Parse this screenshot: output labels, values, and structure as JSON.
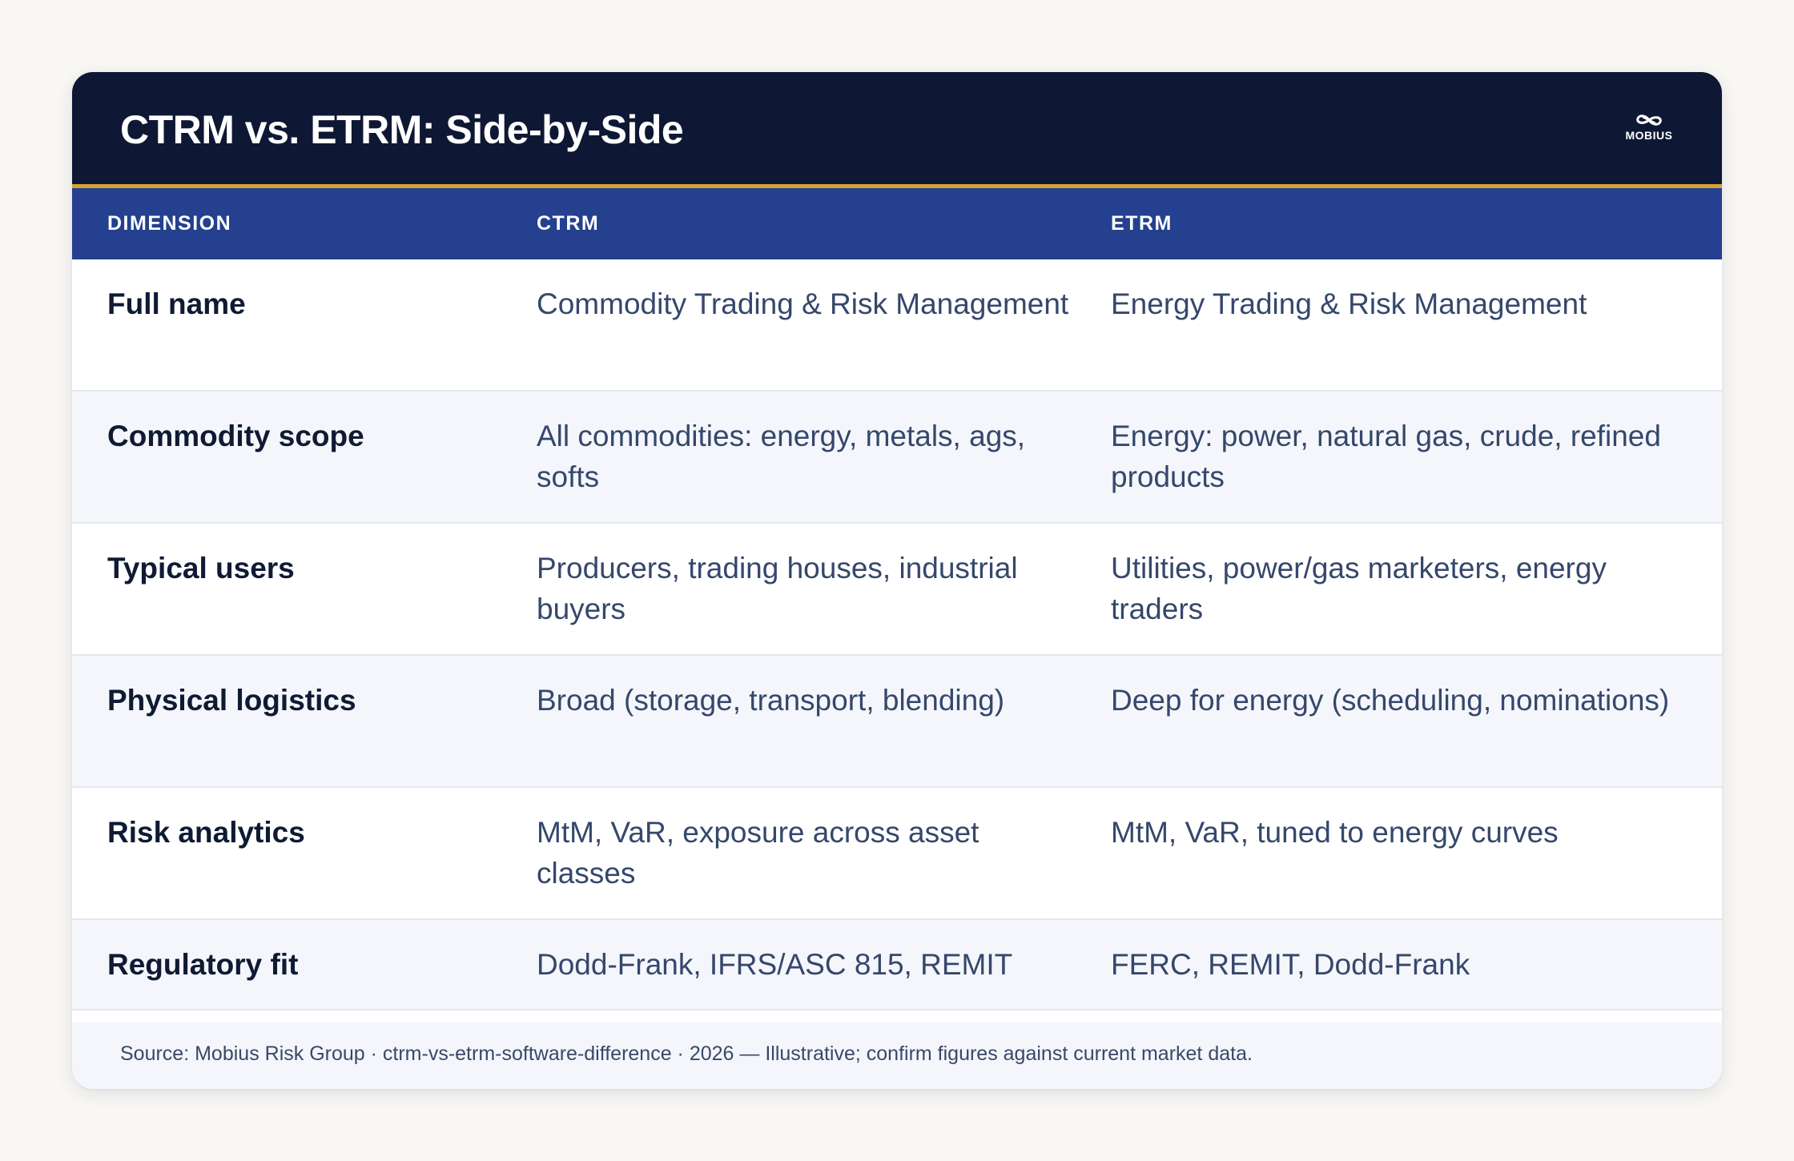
{
  "header": {
    "title": "CTRM vs. ETRM: Side-by-Side",
    "logo_text": "MOBIUS",
    "logo_icon": "infinity-icon"
  },
  "table": {
    "columns": [
      "DIMENSION",
      "CTRM",
      "ETRM"
    ],
    "rows": [
      {
        "dimension": "Full name",
        "ctrm": "Commodity Trading & Risk Management",
        "etrm": "Energy Trading & Risk Management"
      },
      {
        "dimension": "Commodity scope",
        "ctrm": "All commodities: energy, metals, ags, softs",
        "etrm": "Energy: power, natural gas, crude, refined products"
      },
      {
        "dimension": "Typical users",
        "ctrm": "Producers, trading houses, industrial buyers",
        "etrm": "Utilities, power/gas marketers, energy traders"
      },
      {
        "dimension": "Physical logistics",
        "ctrm": "Broad (storage, transport, blending)",
        "etrm": "Deep for energy (scheduling, nominations)"
      },
      {
        "dimension": "Risk analytics",
        "ctrm": "MtM, VaR, exposure across asset classes",
        "etrm": "MtM, VaR, tuned to energy curves"
      },
      {
        "dimension": "Regulatory fit",
        "ctrm": "Dodd-Frank, IFRS/ASC 815, REMIT",
        "etrm": "FERC, REMIT, Dodd-Frank"
      }
    ]
  },
  "footer": {
    "source": "Source: Mobius Risk Group · ctrm-vs-etrm-software-difference · 2026 — Illustrative; confirm figures against current market data."
  },
  "colors": {
    "header_bg": "#0e1834",
    "accent_line": "#d4a434",
    "thead_bg": "#24408e",
    "row_alt_bg": "#f4f6fb",
    "dimension_text": "#0f1a33",
    "body_text": "#35476b"
  }
}
